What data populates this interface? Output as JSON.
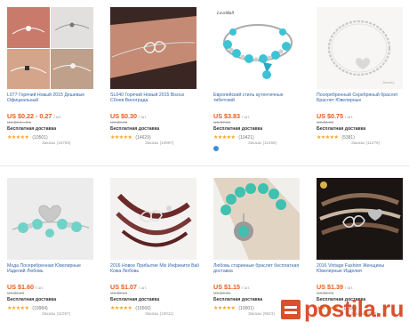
{
  "products": [
    {
      "title": "L077 Горячий Новый 2015 Дешевые Официальный",
      "price": "US $0.22 - 0.27",
      "unit": "/ шт.",
      "old_price": "US $0.4 - 0.5",
      "shipping": "Бесплатная доставка",
      "rating_count": "(10501)",
      "orders": "Заказы (15783)",
      "image": "bracelet-collage"
    },
    {
      "title": "SL040 Горячий Новый 2015 Bisoux Сбоев Виноградa",
      "price": "US $0.30",
      "unit": "/ шт.",
      "old_price": "US $0.40",
      "shipping": "Бесплатная доставка",
      "rating_count": "(14629)",
      "orders": "Заказы (10897)",
      "image": "infinity-bracelet"
    },
    {
      "title": "Европейский стиль аутентичные тибетский",
      "price": "US $3.83",
      "unit": "/ шт.",
      "old_price": "US $7.66",
      "shipping": "Бесплатная доставка",
      "rating_count": "(10421)",
      "orders": "Заказы (11468)",
      "image": "charm-bracelet",
      "brand": "LoveMall"
    },
    {
      "title": "Посеребренный Серебряный браслет Браслет Ювелирные",
      "price": "US $0.75",
      "unit": "/ шт.",
      "old_price": "US $1.00",
      "shipping": "Бесплатная доставка",
      "rating_count": "(5381)",
      "orders": "Заказы (11279)",
      "image": "silver-chain-bracelet"
    },
    {
      "title": "Мода Посеребренная Ювелирные Изделий Любовь",
      "price": "US $1.60",
      "unit": "/ шт.",
      "old_price": "US $3.20",
      "shipping": "Бесплатная доставка",
      "rating_count": "(19984)",
      "orders": "Заказы (11057)",
      "image": "turquoise-heart-bracelet"
    },
    {
      "title": "2016 Новое Прибытие Mix Инфинити Bali Кожа Любовь",
      "price": "US $1.07",
      "unit": "/ шт.",
      "old_price": "US $2.14",
      "shipping": "Бесплатная доставка",
      "rating_count": "(16566)",
      "orders": "Заказы (10011)",
      "image": "leather-infinity-bracelet"
    },
    {
      "title": "Любовь старинные браслет бесплатная доставка",
      "price": "US $1.15",
      "unit": "/ шт.",
      "old_price": "US $2.30",
      "shipping": "Бесплатная доставка",
      "rating_count": "(10001)",
      "orders": "Заказы (9523)",
      "image": "turquoise-bead-bracelet"
    },
    {
      "title": "2016 Vintage Fashion Женщины Ювелирные Изделия",
      "price": "US $1.39",
      "unit": "/ шт.",
      "old_price": "US $2.78",
      "shipping": "Бесплатная доставка",
      "rating_count": "(11090)",
      "orders": "Заказы (9285)",
      "image": "vintage-wrap-bracelet"
    }
  ],
  "watermark": "postila.ru",
  "colors": {
    "price": "#e95b1a",
    "link": "#3366aa",
    "stars": "#f5a623",
    "watermark": "#d9502f"
  }
}
